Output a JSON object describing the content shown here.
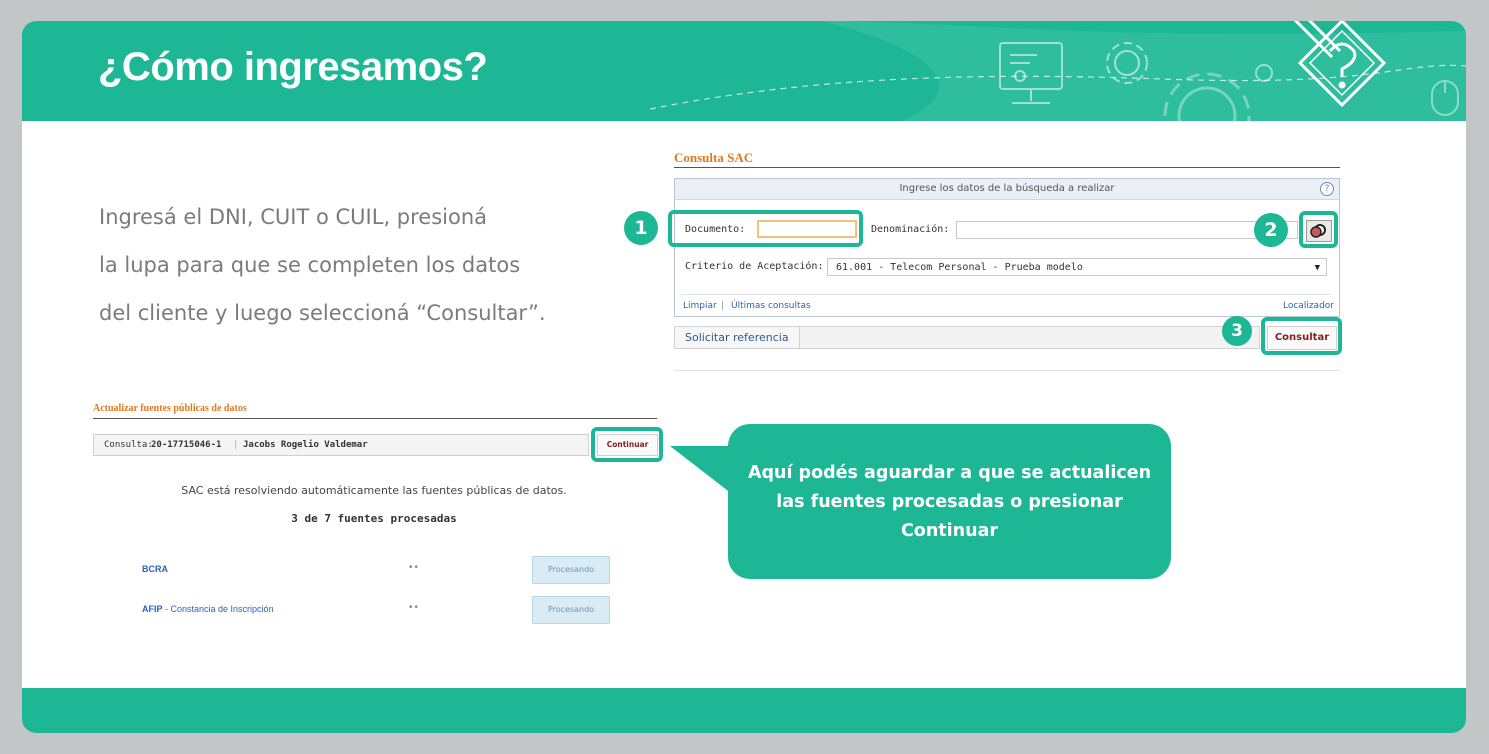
{
  "header": {
    "title": "¿Cómo ingresamos?"
  },
  "intro": {
    "lines": [
      "Ingresá el DNI, CUIT o CUIL, presioná",
      "la lupa para que se completen los datos",
      "del cliente y luego seleccioná “Consultar”."
    ]
  },
  "sac": {
    "title": "Consulta SAC",
    "instructions": "Ingrese los datos de la búsqueda a realizar",
    "help": "?",
    "documento_label": "Documento:",
    "documento_value": "",
    "denominacion_label": "Denominación:",
    "denominacion_value": "",
    "criterio_label": "Criterio de Aceptación:",
    "criterio_value": "61.001 - Telecom Personal - Prueba modelo",
    "links": {
      "limpiar": "Limpiar",
      "separator": "|",
      "ultimas": "Últimas consultas",
      "localizador": "Localizador"
    },
    "solicitar_label": "Solicitar referencia",
    "consultar_label": "Consultar"
  },
  "steps": [
    "1",
    "2",
    "3"
  ],
  "actualizar": {
    "title": "Actualizar fuentes públicas de datos",
    "consulta_label": "Consulta:",
    "consulta_id": "20-17715046-1",
    "nombre": "Jacobs Rogelio Valdemar",
    "continuar_label": "Continuar",
    "resolving_text": "SAC está resolviendo automáticamente las fuentes públicas de datos.",
    "processed_text": "3 de 7 fuentes procesadas",
    "sources": [
      {
        "name": "BCRA",
        "detail": "",
        "dots": "••",
        "status": "Procesando"
      },
      {
        "name": "AFIP",
        "detail": " - Constancia de Inscripción",
        "dots": "••",
        "status": "Procesando"
      }
    ]
  },
  "callout": {
    "lines": [
      "Aquí podés aguardar a que se actualicen",
      "las fuentes procesadas o presionar",
      "Continuar"
    ]
  },
  "colors": {
    "brand": "#1eb795",
    "accent_orange": "#e07a1f",
    "button_red": "#8b1a1a",
    "link_blue": "#2c63b8"
  },
  "icons": [
    "monitor-icon",
    "gear-icon",
    "gear-large-icon",
    "mouse-icon",
    "pencil-question-icon",
    "help-icon",
    "search-icon",
    "chevron-down-icon"
  ]
}
